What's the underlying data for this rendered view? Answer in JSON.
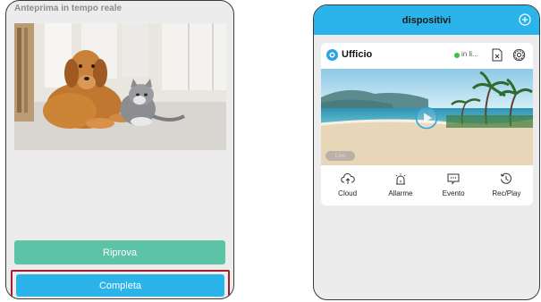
{
  "left_screen": {
    "preview_title": "Anteprima in tempo reale",
    "retry_label": "Riprova",
    "complete_label": "Completa"
  },
  "right_screen": {
    "header_title": "dispositivi",
    "device": {
      "name": "Ufficio",
      "status": "in li...",
      "live_badge": "Live"
    },
    "actions": [
      {
        "label": "Cloud",
        "icon": "cloud-upload-icon"
      },
      {
        "label": "Allarme",
        "icon": "alarm-icon"
      },
      {
        "label": "Evento",
        "icon": "event-icon"
      },
      {
        "label": "Rec/Play",
        "icon": "history-icon"
      }
    ]
  },
  "colors": {
    "accent_blue": "#2bb4ea",
    "retry_green": "#5cc3a7",
    "highlight_red": "#a1202b",
    "status_green": "#35c24a"
  }
}
